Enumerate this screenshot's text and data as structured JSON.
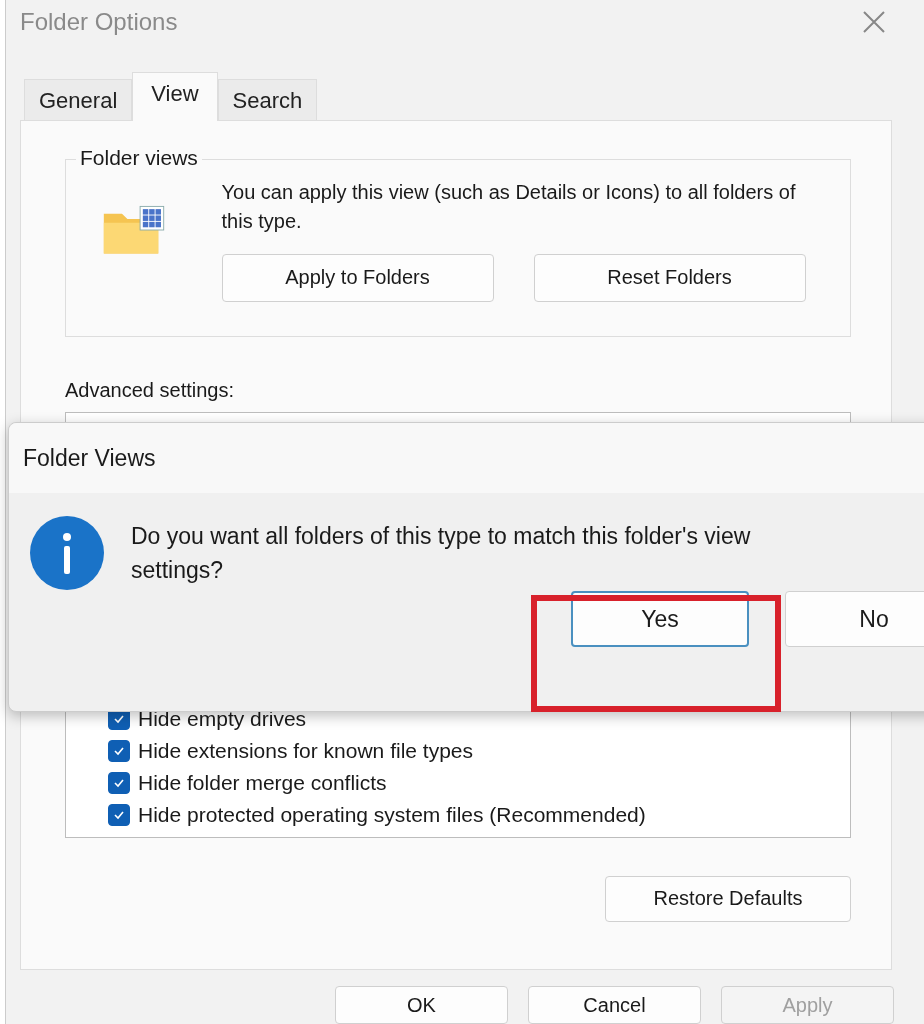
{
  "window": {
    "title": "Folder Options"
  },
  "tabs": [
    {
      "label": "General",
      "selected": false
    },
    {
      "label": "View",
      "selected": true
    },
    {
      "label": "Search",
      "selected": false
    }
  ],
  "folder_views": {
    "title": "Folder views",
    "description": "You can apply this view (such as Details or Icons) to all folders of this type.",
    "buttons": [
      "Apply to Folders",
      "Reset Folders"
    ]
  },
  "advanced_settings": {
    "label": "Advanced settings:",
    "items": [
      {
        "label": "Hide empty drives",
        "checked": true
      },
      {
        "label": "Hide extensions for known file types",
        "checked": true
      },
      {
        "label": "Hide folder merge conflicts",
        "checked": true
      },
      {
        "label": "Hide protected operating system files (Recommended)",
        "checked": true
      }
    ]
  },
  "restore_button": "Restore Defaults",
  "footer_buttons": [
    {
      "label": "OK",
      "disabled": false
    },
    {
      "label": "Cancel",
      "disabled": false
    },
    {
      "label": "Apply",
      "disabled": true
    }
  ],
  "dialog": {
    "title": "Folder Views",
    "message": "Do you want all folders of this type to match this folder's view settings?",
    "buttons": [
      {
        "label": "Yes",
        "selected": true
      },
      {
        "label": "No",
        "selected": false
      }
    ]
  }
}
